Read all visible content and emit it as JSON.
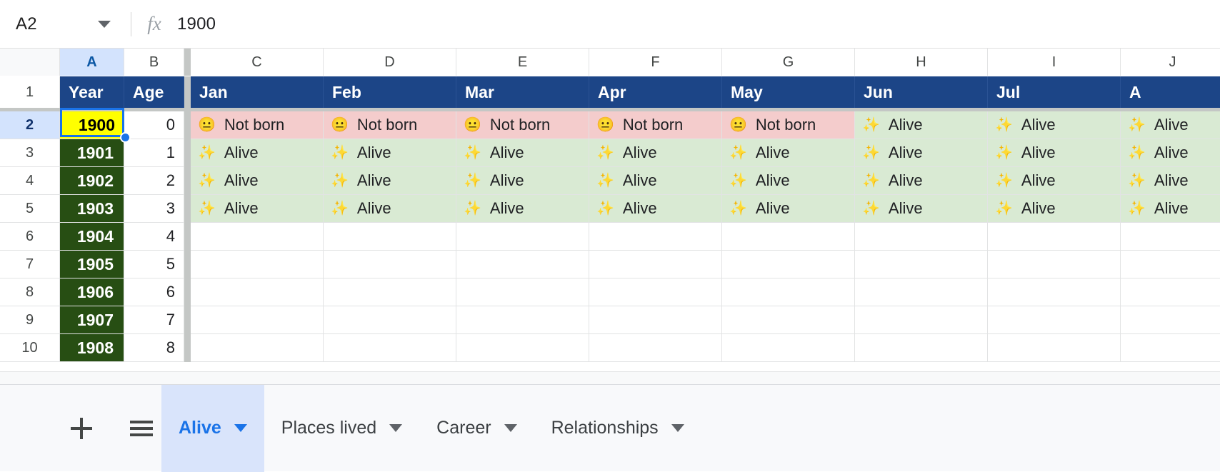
{
  "formula_bar": {
    "name_box_value": "A2",
    "name_box_caret_icon": "chevron-down-icon",
    "fx_icon": "fx-icon",
    "fx_label": "fx",
    "formula_value": "1900"
  },
  "grid": {
    "column_headers": [
      "A",
      "B",
      "C",
      "D",
      "E",
      "F",
      "G",
      "H",
      "I",
      "J"
    ],
    "selected_column": "A",
    "selected_row": "2",
    "row_numbers": [
      "1",
      "2",
      "3",
      "4",
      "5",
      "6",
      "7",
      "8",
      "9",
      "10"
    ],
    "header_row": {
      "row_number": "1",
      "cells": [
        "Year",
        "Age",
        "Jan",
        "Feb",
        "Mar",
        "Apr",
        "May",
        "Jun",
        "Jul",
        "A"
      ]
    },
    "emoji": {
      "not_born": "😐",
      "alive": "✨"
    },
    "labels": {
      "not_born": "Not born",
      "alive": "Alive"
    },
    "rows": [
      {
        "row_number": "2",
        "year": "1900",
        "age": "0",
        "selected": true,
        "months": [
          "not_born",
          "not_born",
          "not_born",
          "not_born",
          "not_born",
          "alive",
          "alive",
          "alive"
        ]
      },
      {
        "row_number": "3",
        "year": "1901",
        "age": "1",
        "selected": false,
        "months": [
          "alive",
          "alive",
          "alive",
          "alive",
          "alive",
          "alive",
          "alive",
          "alive"
        ]
      },
      {
        "row_number": "4",
        "year": "1902",
        "age": "2",
        "selected": false,
        "months": [
          "alive",
          "alive",
          "alive",
          "alive",
          "alive",
          "alive",
          "alive",
          "alive"
        ]
      },
      {
        "row_number": "5",
        "year": "1903",
        "age": "3",
        "selected": false,
        "months": [
          "alive",
          "alive",
          "alive",
          "alive",
          "alive",
          "alive",
          "alive",
          "alive"
        ]
      },
      {
        "row_number": "6",
        "year": "1904",
        "age": "4",
        "selected": false,
        "months": [
          "",
          "",
          "",
          "",
          "",
          "",
          "",
          ""
        ]
      },
      {
        "row_number": "7",
        "year": "1905",
        "age": "5",
        "selected": false,
        "months": [
          "",
          "",
          "",
          "",
          "",
          "",
          "",
          ""
        ]
      },
      {
        "row_number": "8",
        "year": "1906",
        "age": "6",
        "selected": false,
        "months": [
          "",
          "",
          "",
          "",
          "",
          "",
          "",
          ""
        ]
      },
      {
        "row_number": "9",
        "year": "1907",
        "age": "7",
        "selected": false,
        "months": [
          "",
          "",
          "",
          "",
          "",
          "",
          "",
          ""
        ]
      },
      {
        "row_number": "10",
        "year": "1908",
        "age": "8",
        "selected": false,
        "months": [
          "",
          "",
          "",
          "",
          "",
          "",
          "",
          ""
        ]
      }
    ]
  },
  "tab_bar": {
    "add_sheet_icon": "plus-icon",
    "all_sheets_icon": "hamburger-menu-icon",
    "tabs": [
      {
        "label": "Alive",
        "active": true
      },
      {
        "label": "Places lived",
        "active": false
      },
      {
        "label": "Career",
        "active": false
      },
      {
        "label": "Relationships",
        "active": false
      }
    ]
  },
  "colors": {
    "header_navy": "#1c4587",
    "year_green": "#274e13",
    "selected_yellow": "#ffff00",
    "not_born_pink": "#f4cccc",
    "alive_green": "#d9ead3",
    "accent_blue": "#1a73e8",
    "tab_active_bg": "#d9e4fb"
  }
}
